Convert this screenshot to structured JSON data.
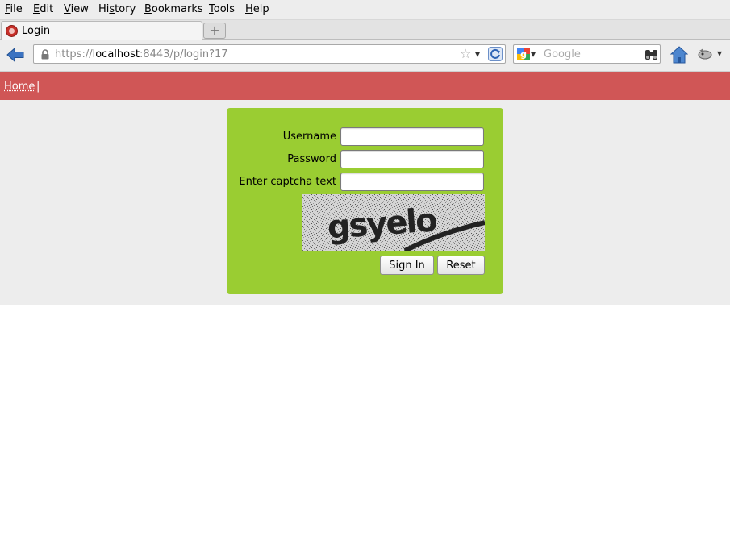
{
  "menu": [
    {
      "label": "File",
      "accel": "F",
      "rest": "ile"
    },
    {
      "label": "Edit",
      "accel": "E",
      "rest": "dit"
    },
    {
      "label": "View",
      "accel": "V",
      "rest": "iew"
    },
    {
      "label": "History",
      "pre": "Hi",
      "accel": "s",
      "rest": "tory"
    },
    {
      "label": "Bookmarks",
      "accel": "B",
      "rest": "ookmarks"
    },
    {
      "label": "Tools",
      "accel": "T",
      "rest": "ools"
    },
    {
      "label": "Help",
      "accel": "H",
      "rest": "elp"
    }
  ],
  "tab": {
    "title": "Login",
    "new_tab_glyph": "+"
  },
  "address": {
    "scheme": "https://",
    "host": "localhost",
    "rest": ":8443/p/login?17"
  },
  "search": {
    "placeholder": "Google"
  },
  "nav": {
    "home_link": "Home",
    "separator": "|"
  },
  "login": {
    "username_label": "Username",
    "password_label": "Password",
    "captcha_label": "Enter captcha text",
    "username_value": "",
    "password_value": "",
    "captcha_value": "",
    "captcha_image_text": "gsyelo",
    "sign_in_label": "Sign In",
    "reset_label": "Reset"
  },
  "colors": {
    "nav_bar": "#d05656",
    "login_panel": "#9acd32",
    "page_background": "#ededed"
  },
  "icons": [
    "back-arrow-icon",
    "lock-icon",
    "bookmark-star-icon",
    "reload-icon",
    "google-logo-icon",
    "binoculars-icon",
    "home-icon",
    "addon-icon"
  ]
}
